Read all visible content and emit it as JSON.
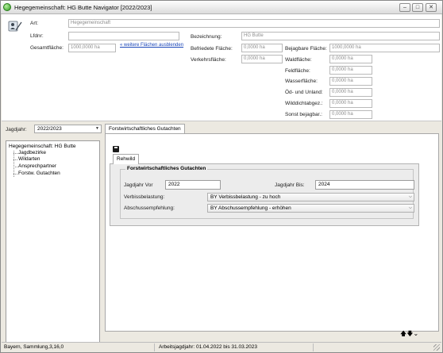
{
  "window": {
    "title": "Hegegemeinschaft: HG Butte Navigator [2022/2023]",
    "min_label": "–",
    "max_label": "□",
    "close_label": "✕"
  },
  "details": {
    "art_label": "Art:",
    "art_value": "Hegegemeinschaft",
    "lfdnr_label": "Lfdnr:",
    "lfdnr_value": "",
    "bezeichnung_label": "Bezeichnung:",
    "bezeichnung_value": "HG Butte",
    "gesamtflaeche_label": "Gesamtfläche:",
    "gesamtflaeche_value": "1000,0000 ha",
    "weitere_link": "« weitere Flächen ausblenden",
    "befriedete_label": "Befriedete Fläche:",
    "befriedete_value": "0,0000 ha",
    "verkehrs_label": "Verkehrsfläche:",
    "verkehrs_value": "0,0000 ha",
    "bejagbare_label": "Bejagbare Fläche:",
    "bejagbare_value": "1000,0000 ha",
    "wald_label": "Waldfläche:",
    "wald_value": "0,0000 ha",
    "feld_label": "Feldfläche:",
    "feld_value": "0,0000 ha",
    "wasser_label": "Wasserfläche:",
    "wasser_value": "0,0000 ha",
    "oed_label": "Öd- und Unland:",
    "oed_value": "0,0000 ha",
    "wilddicht_label": "Wilddichtabgez.:",
    "wilddicht_value": "0,0000 ha",
    "sonst_label": "Sonst bejagbar.:",
    "sonst_value": "0,0000 ha"
  },
  "jagdjahr": {
    "label": "Jagdjahr:",
    "value": "2022/2023",
    "arrow": "▼"
  },
  "tree": {
    "root": "Hegegemeinschaft: HG Butte",
    "children": [
      "Jagdbezirke",
      "Wildarten",
      "Ansprechpartner",
      "Forstw. Gutachten"
    ]
  },
  "tabs": {
    "main_tab": "Forstwirtschaftliches Gutachten",
    "sub_tab": "Rehwild"
  },
  "gutachten": {
    "group_title": "Forstwirtschaftliches Gutachten",
    "jagdjahr_vor_label": "Jagdjahr Vor",
    "jagdjahr_vor_value": "2022",
    "jagdjahr_bis_label": "Jagdjahr Bis:",
    "jagdjahr_bis_value": "2024",
    "verbiss_label": "Verbissbelastung:",
    "verbiss_value": "BY Verbissbelastung - zu hoch",
    "abschuss_label": "Abschussempfehlung:",
    "abschuss_value": "BY Abschussempfehlung - erhöhen",
    "combo_arrow": "⌵"
  },
  "nav": {
    "arrows": "🡅🡇⌄"
  },
  "status": {
    "left": "Bayern, Sammlung,3,16,0",
    "right": "Arbeitsjagdjahr: 01.04.2022 bis 31.03.2023"
  }
}
